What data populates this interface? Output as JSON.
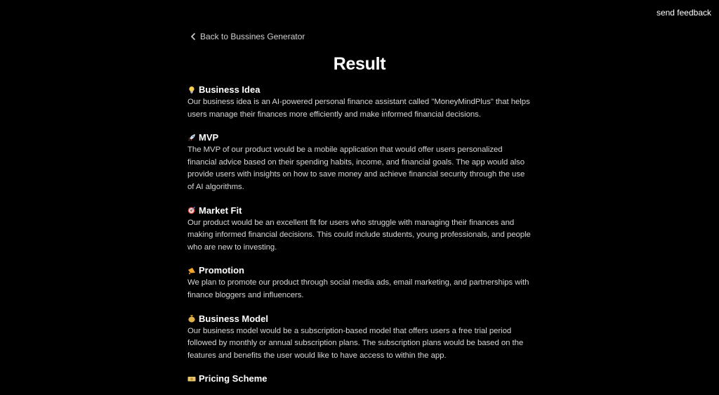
{
  "header": {
    "feedback_label": "send feedback"
  },
  "nav": {
    "back_label": "Back to Bussines Generator"
  },
  "page": {
    "title": "Result"
  },
  "sections": [
    {
      "icon": "lightbulb-icon",
      "heading": "Business Idea",
      "body": "Our business idea is an AI-powered personal finance assistant called \"MoneyMindPlus\" that helps users manage their finances more efficiently and make informed financial decisions."
    },
    {
      "icon": "rocket-icon",
      "heading": "MVP",
      "body": "The MVP of our product would be a mobile application that would offer users personalized financial advice based on their spending habits, income, and financial goals. The app would also provide users with insights on how to save money and achieve financial security through the use of AI algorithms."
    },
    {
      "icon": "target-icon",
      "heading": "Market Fit",
      "body": "Our product would be an excellent fit for users who struggle with managing their finances and making informed financial decisions. This could include students, young professionals, and people who are new to investing."
    },
    {
      "icon": "megaphone-icon",
      "heading": "Promotion",
      "body": "We plan to promote our product through social media ads, email marketing, and partnerships with finance bloggers and influencers."
    },
    {
      "icon": "money-bag-icon",
      "heading": "Business Model",
      "body": "Our business model would be a subscription-based model that offers users a free trial period followed by monthly or annual subscription plans. The subscription plans would be based on the features and benefits the user would like to have access to within the app."
    },
    {
      "icon": "banknote-icon",
      "heading": "Pricing Scheme",
      "body": ""
    }
  ]
}
